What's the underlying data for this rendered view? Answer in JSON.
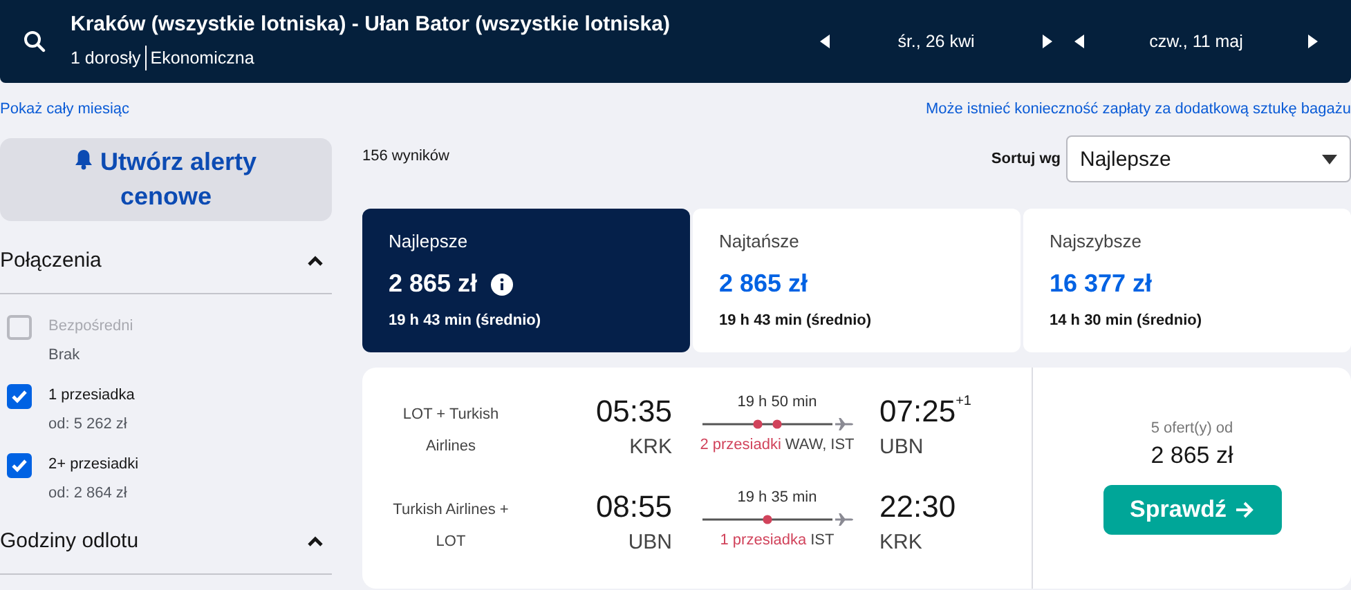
{
  "header": {
    "route": "Kraków (wszystkie lotniska) - Ułan Bator (wszystkie lotniska)",
    "passengers": "1 dorosły",
    "cabin": "Ekonomiczna",
    "dates": [
      {
        "label": "śr., 26 kwi"
      },
      {
        "label": "czw., 11 maj"
      }
    ]
  },
  "links": {
    "month": "Pokaż cały miesiąc",
    "baggage": "Może istnieć konieczność zapłaty za dodatkową sztukę bagażu"
  },
  "sidebar": {
    "alert_button": "Utwórz alerty cenowe",
    "sections": [
      {
        "title": "Połączenia",
        "expanded": true,
        "options": [
          {
            "label": "Bezpośredni",
            "detail": "Brak",
            "checked": false,
            "disabled": true
          },
          {
            "label": "1 przesiadka",
            "detail": "od: 5 262 zł",
            "checked": true,
            "disabled": false
          },
          {
            "label": "2+ przesiadki",
            "detail": "od: 2 864 zł",
            "checked": true,
            "disabled": false
          }
        ]
      },
      {
        "title": "Godziny odlotu",
        "expanded": true
      }
    ]
  },
  "results": {
    "count": "156 wyników",
    "sort_label": "Sortuj wg",
    "sort_value": "Najlepsze",
    "tabs": [
      {
        "label": "Najlepsze",
        "price": "2 865 zł",
        "duration": "19 h 43 min (średnio)",
        "info": true,
        "selected": true
      },
      {
        "label": "Najtańsze",
        "price": "2 865 zł",
        "duration": "19 h 43 min (średnio)",
        "info": false,
        "selected": false
      },
      {
        "label": "Najszybsze",
        "price": "16 377 zł",
        "duration": "14 h 30 min (średnio)",
        "info": false,
        "selected": false
      }
    ],
    "offer": {
      "legs": [
        {
          "airline": "LOT + Turkish Airlines",
          "depart": "05:35",
          "depart_airport": "KRK",
          "duration": "19 h 50 min",
          "stops": "2 przesiadki",
          "layovers": [
            "WAW,",
            "IST"
          ],
          "arrive": "07:25",
          "day_offset": "+1",
          "arrive_airport": "UBN"
        },
        {
          "airline": "Turkish Airlines + LOT",
          "depart": "08:55",
          "depart_airport": "UBN",
          "duration": "19 h 35 min",
          "stops": "1 przesiadka",
          "layovers": [
            "IST"
          ],
          "arrive": "22:30",
          "arrive_airport": "KRK"
        }
      ],
      "offers_count": "5 ofert(y) od",
      "price": "2 865 zł",
      "button": "Sprawdź"
    }
  }
}
